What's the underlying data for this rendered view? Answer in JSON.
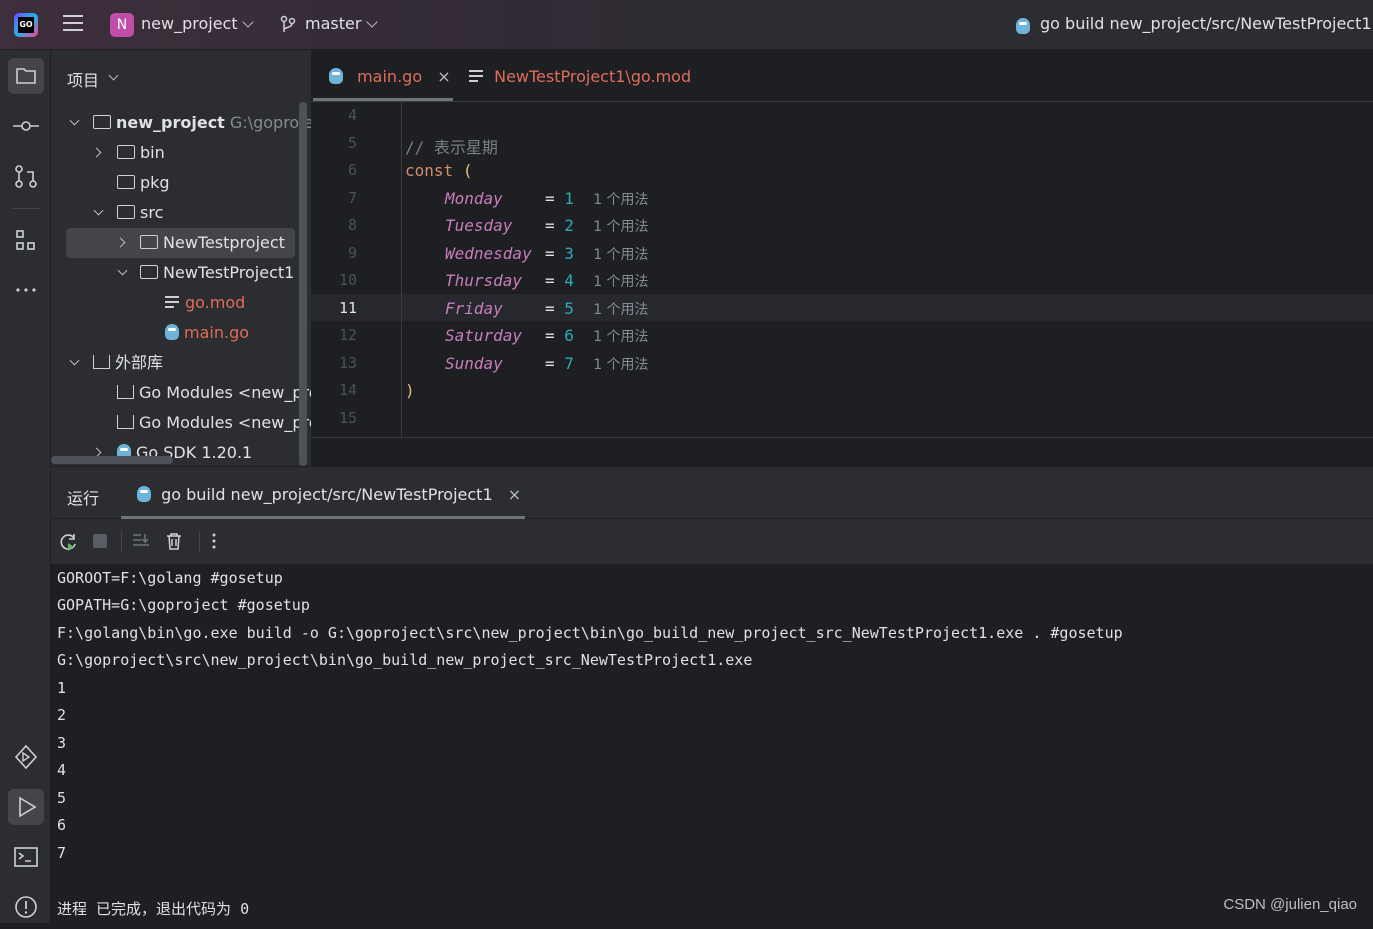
{
  "topbar": {
    "logo_text": "GO",
    "project_letter": "N",
    "project_name": "new_project",
    "branch": "master",
    "run_config": "go build new_project/src/NewTestProject1"
  },
  "sidebar": {
    "icons": [
      "folder-icon",
      "commit-icon",
      "pull-request-icon",
      "structure-icon",
      "more-icon",
      "services-icon",
      "run-icon",
      "terminal-icon",
      "problems-icon"
    ]
  },
  "project_panel": {
    "title": "项目",
    "tree": [
      {
        "label": "new_project",
        "path": "G:\\goproject",
        "expanded": true
      },
      {
        "label": "bin"
      },
      {
        "label": "pkg"
      },
      {
        "label": "src",
        "expanded": true
      },
      {
        "label": "NewTestproject",
        "selected": true
      },
      {
        "label": "NewTestProject1",
        "expanded": true
      },
      {
        "label": "go.mod"
      },
      {
        "label": "main.go"
      },
      {
        "label": "外部库",
        "expanded": true
      },
      {
        "label": "Go Modules <new_pro"
      },
      {
        "label": "Go Modules <new_pro"
      },
      {
        "label": "Go SDK 1.20.1"
      }
    ]
  },
  "editor": {
    "tabs": [
      {
        "label": "main.go",
        "active": true
      },
      {
        "label": "NewTestProject1\\go.mod"
      }
    ],
    "line_numbers": [
      "4",
      "5",
      "6",
      "7",
      "8",
      "9",
      "10",
      "11",
      "12",
      "13",
      "14",
      "15"
    ],
    "comment": "// 表示星期",
    "const_kw": "const",
    "open_paren": "(",
    "close_paren": ")",
    "constants": [
      {
        "name": "Monday",
        "value": "1",
        "hint": "1 个用法"
      },
      {
        "name": "Tuesday",
        "value": "2",
        "hint": "1 个用法"
      },
      {
        "name": "Wednesday",
        "value": "3",
        "hint": "1 个用法"
      },
      {
        "name": "Thursday",
        "value": "4",
        "hint": "1 个用法"
      },
      {
        "name": "Friday",
        "value": "5",
        "hint": "1 个用法"
      },
      {
        "name": "Saturday",
        "value": "6",
        "hint": "1 个用法"
      },
      {
        "name": "Sunday",
        "value": "7",
        "hint": "1 个用法"
      }
    ],
    "eq": "="
  },
  "run_panel": {
    "title": "运行",
    "tab_label": "go build new_project/src/NewTestProject1",
    "output": [
      "GOROOT=F:\\golang #gosetup",
      "GOPATH=G:\\goproject #gosetup",
      "F:\\golang\\bin\\go.exe build -o G:\\goproject\\src\\new_project\\bin\\go_build_new_project_src_NewTestProject1.exe . #gosetup",
      "G:\\goproject\\src\\new_project\\bin\\go_build_new_project_src_NewTestProject1.exe",
      "1",
      "2",
      "3",
      "4",
      "5",
      "6",
      "7",
      "",
      "进程 已完成，退出代码为 0"
    ]
  },
  "watermark": "CSDN @julien_qiao"
}
